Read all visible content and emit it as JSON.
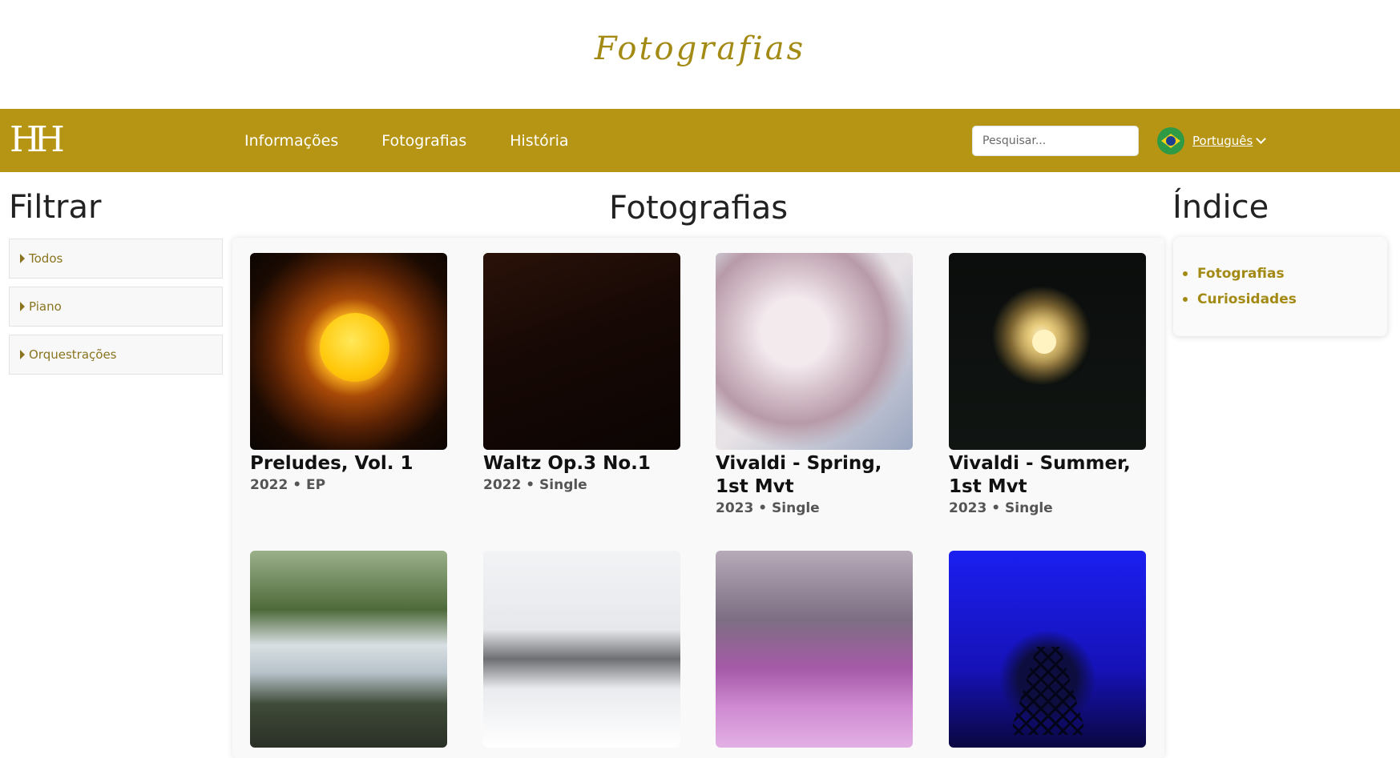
{
  "brand": {
    "site_title": "Fotografias",
    "logo_text": "HH",
    "accent_color": "#b79514",
    "link_color": "#a38a14"
  },
  "nav": {
    "links": [
      "Informações",
      "Fotografias",
      "História"
    ],
    "search_placeholder": "Pesquisar...",
    "language": {
      "label": "Português",
      "flag_icon": "brazil-flag-icon"
    }
  },
  "filter": {
    "title": "Filtrar",
    "items": [
      "Todos",
      "Piano",
      "Orquestrações"
    ]
  },
  "main": {
    "title": "Fotografias",
    "cards": [
      {
        "title": "Preludes, Vol. 1",
        "meta": "2022 • EP"
      },
      {
        "title": "Waltz Op.3 No.1",
        "meta": "2022 • Single"
      },
      {
        "title": "Vivaldi - Spring, 1st Mvt",
        "meta": "2023 • Single"
      },
      {
        "title": "Vivaldi - Summer, 1st Mvt",
        "meta": "2023 • Single"
      },
      {
        "title": "",
        "meta": ""
      },
      {
        "title": "",
        "meta": ""
      },
      {
        "title": "",
        "meta": ""
      },
      {
        "title": "",
        "meta": ""
      }
    ]
  },
  "index": {
    "title": "Índice",
    "items": [
      "Fotografias",
      "Curiosidades"
    ]
  }
}
